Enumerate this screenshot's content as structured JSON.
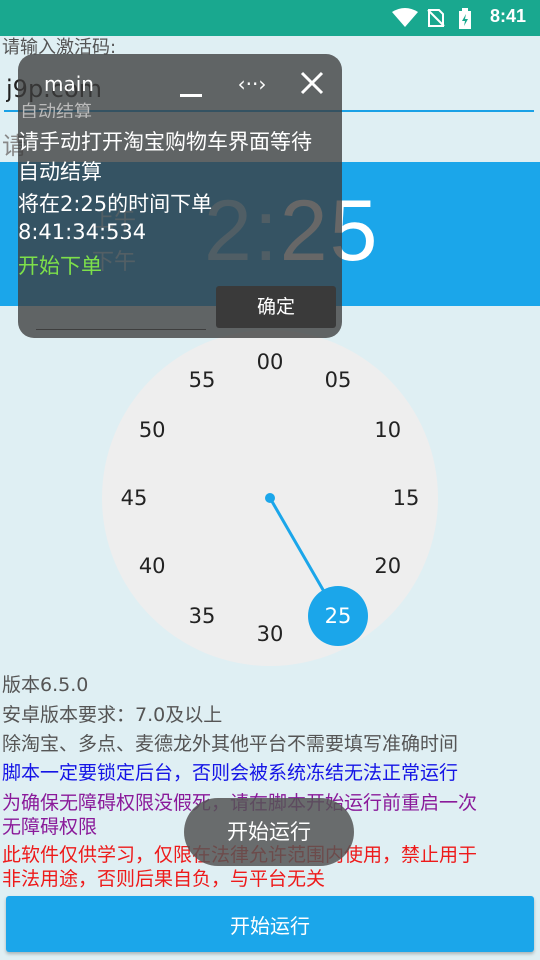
{
  "status_bar": {
    "time": "8:41",
    "icons": [
      "wifi-icon",
      "no-sim-icon",
      "battery-charging-icon"
    ],
    "color": "#19a88f"
  },
  "activation": {
    "label": "请输入激活码:",
    "value": "j9p.com",
    "ghost_label": "请"
  },
  "time_picker": {
    "hour": "2",
    "separator": ":",
    "minute": "25",
    "am_label": "上午",
    "pm_label": "下午",
    "accent": "#1ba6ea",
    "minute_numbers": [
      "00",
      "05",
      "10",
      "15",
      "20",
      "25",
      "30",
      "35",
      "40",
      "45",
      "50",
      "55"
    ],
    "selected_minute": "25"
  },
  "overlay": {
    "title": "main",
    "behind_text": "自动结算",
    "lines": [
      "请手动打开淘宝购物车界面等待",
      "自动结算",
      "将在2:25的时间下单",
      "8:41:34:534"
    ],
    "status": "开始下单",
    "ok_label": "确定"
  },
  "info": {
    "version": "版本6.5.0",
    "android_req": "安卓版本要求：7.0及以上",
    "platform_note": "除淘宝、多点、麦德龙外其他平台不需要填写准确时间",
    "lock_note": "脚本一定要锁定后台，否则会被系统冻结无法正常运行",
    "a11y_note_1": "为确保无障碍权限没假死，请在脚本开始运行前重启一次",
    "a11y_note_2": "无障碍权限",
    "disclaimer_1": "此软件仅供学习，仅限在法律允许范围内使用，禁止用于",
    "disclaimer_2": "非法用途，否则后果自负，与平台无关"
  },
  "toast": "开始运行",
  "start_button": "开始运行"
}
